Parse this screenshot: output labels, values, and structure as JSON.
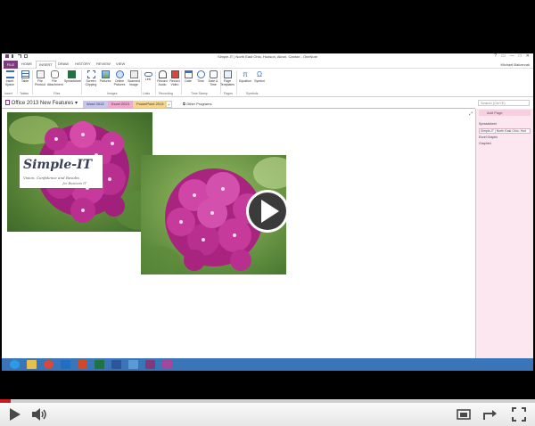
{
  "window": {
    "title": "Simple-IT | North East Ohio, Hudson, Akron, Canton - OneNote",
    "controls": [
      "?",
      "▭",
      "—",
      "□",
      "✕"
    ],
    "user": "Michael Balcerzak"
  },
  "ribbon_tabs": [
    {
      "label": "FILE",
      "active": false
    },
    {
      "label": "HOME",
      "active": false
    },
    {
      "label": "INSERT",
      "active": true
    },
    {
      "label": "DRAW",
      "active": false
    },
    {
      "label": "HISTORY",
      "active": false
    },
    {
      "label": "REVIEW",
      "active": false
    },
    {
      "label": "VIEW",
      "active": false
    }
  ],
  "ribbon_buttons": [
    {
      "label": "Insert\nSpace",
      "icon": "insert-space-icon"
    },
    {
      "label": "Table",
      "icon": "table-icon"
    },
    {
      "label": "File\nPrintout",
      "icon": "file-printout-icon"
    },
    {
      "label": "File\nAttachment",
      "icon": "attachment-icon"
    },
    {
      "label": "Spreadsheet",
      "icon": "spreadsheet-icon"
    },
    {
      "label": "Screen\nClipping",
      "icon": "screen-clipping-icon"
    },
    {
      "label": "Pictures",
      "icon": "pictures-icon"
    },
    {
      "label": "Online\nPictures",
      "icon": "online-pictures-icon"
    },
    {
      "label": "Scanned\nImage",
      "icon": "scanned-image-icon"
    },
    {
      "label": "Link",
      "icon": "link-icon"
    },
    {
      "label": "Record\nAudio",
      "icon": "record-audio-icon"
    },
    {
      "label": "Record\nVideo",
      "icon": "record-video-icon"
    },
    {
      "label": "Date",
      "icon": "date-icon"
    },
    {
      "label": "Time",
      "icon": "time-icon"
    },
    {
      "label": "Date &\nTime",
      "icon": "date-time-icon"
    },
    {
      "label": "Page\nTemplates",
      "icon": "page-templates-icon"
    },
    {
      "label": "Equation",
      "icon": "equation-icon"
    },
    {
      "label": "Symbol",
      "icon": "symbol-icon"
    }
  ],
  "ribbon_groups": [
    "Insert",
    "Tables",
    "Files",
    "Images",
    "Links",
    "Recording",
    "Time Stamp",
    "Pages",
    "Symbols"
  ],
  "notebook": {
    "name": "Office 2013 New Features"
  },
  "section_tabs": [
    {
      "label": "Word 2013",
      "color": "#c6c6ee"
    },
    {
      "label": "Excel 2013",
      "color": "#f2a7cb"
    },
    {
      "label": "PowerPoint 2013",
      "color": "#f5d68b"
    },
    {
      "label": "+",
      "color": "#ffffff"
    },
    {
      "label": "Other Programs",
      "color": "#ffffff"
    }
  ],
  "search": {
    "placeholder": "Search (Ctrl+E)"
  },
  "page_list": {
    "add_page": "Add Page",
    "items": [
      "Spreadsheet",
      "Simple-IT | North East Ohio, Hud",
      "Excel Graphs",
      "Graphed"
    ]
  },
  "logo": {
    "main": "Simple-IT",
    "sub": "Vision, Confidence and Results",
    "sub2": "for Business IT"
  },
  "taskbar_icons": [
    {
      "name": "ie-icon",
      "color": "#2b9be8"
    },
    {
      "name": "explorer-icon",
      "color": "#e6c04a"
    },
    {
      "name": "chrome-icon",
      "color": "#d9483b"
    },
    {
      "name": "outlook-icon",
      "color": "#1f6fc5"
    },
    {
      "name": "powerpoint-icon",
      "color": "#d24726"
    },
    {
      "name": "excel-icon",
      "color": "#207245"
    },
    {
      "name": "word-icon",
      "color": "#2b579a"
    },
    {
      "name": "snagit-icon",
      "color": "#5a9bd5"
    },
    {
      "name": "onenote-icon",
      "color": "#80397b"
    },
    {
      "name": "onenote2-icon",
      "color": "#a04899"
    }
  ],
  "player": {
    "progress": 0.02,
    "accent": "#cc181e"
  }
}
